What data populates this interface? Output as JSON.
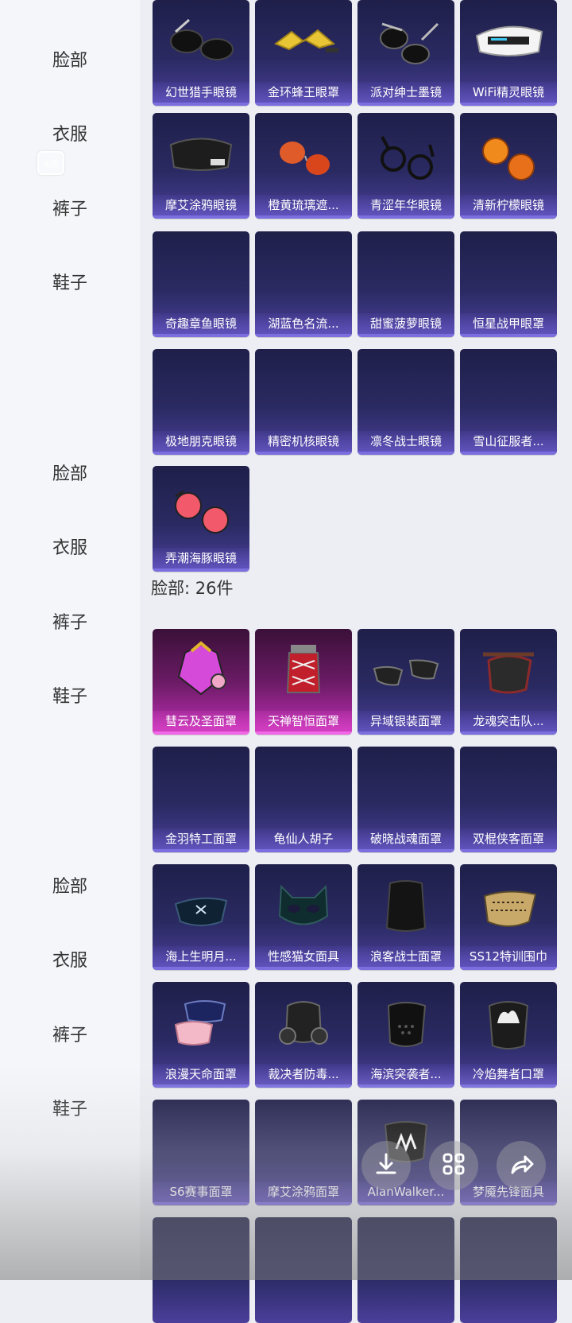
{
  "sidebar": {
    "items": [
      {
        "label": "脸部"
      },
      {
        "label": "衣服"
      },
      {
        "label": "裤子"
      },
      {
        "label": "鞋子"
      },
      {
        "label": "脸部"
      },
      {
        "label": "衣服"
      },
      {
        "label": "裤子"
      },
      {
        "label": "鞋子"
      },
      {
        "label": "脸部"
      },
      {
        "label": "衣服"
      },
      {
        "label": "裤子"
      },
      {
        "label": "鞋子"
      }
    ],
    "long_screenshot_badge": "长图"
  },
  "glasses": [
    {
      "name": "幻世猎手眼镜"
    },
    {
      "name": "金环蜂王眼罩"
    },
    {
      "name": "派对绅士墨镜"
    },
    {
      "name": "WiFi精灵眼镜"
    },
    {
      "name": "摩艾涂鸦眼镜"
    },
    {
      "name": "橙黄琉璃遮..."
    },
    {
      "name": "青涩年华眼镜"
    },
    {
      "name": "清新柠檬眼镜"
    },
    {
      "name": "奇趣章鱼眼镜"
    },
    {
      "name": "湖蓝色名流..."
    },
    {
      "name": "甜蜜菠萝眼镜"
    },
    {
      "name": "恒星战甲眼罩"
    },
    {
      "name": "极地朋克眼镜"
    },
    {
      "name": "精密机核眼镜"
    },
    {
      "name": "凛冬战士眼镜"
    },
    {
      "name": "雪山征服者..."
    },
    {
      "name": "弄潮海豚眼镜"
    }
  ],
  "face_section": {
    "title": "脸部: 26件"
  },
  "face_items": [
    {
      "name": "彗云及圣面罩"
    },
    {
      "name": "天禅智恒面罩"
    },
    {
      "name": "异域银装面罩"
    },
    {
      "name": "龙魂突击队..."
    },
    {
      "name": "金羽特工面罩"
    },
    {
      "name": "龟仙人胡子"
    },
    {
      "name": "破晓战魂面罩"
    },
    {
      "name": "双棍侠客面罩"
    },
    {
      "name": "海上生明月..."
    },
    {
      "name": "性感猫女面具"
    },
    {
      "name": "浪客战士面罩"
    },
    {
      "name": "SS12特训围巾"
    },
    {
      "name": "浪漫天命面罩"
    },
    {
      "name": "裁决者防毒..."
    },
    {
      "name": "海滨突袭者..."
    },
    {
      "name": "冷焰舞者口罩"
    },
    {
      "name": "S6赛事面罩"
    },
    {
      "name": "摩艾涂鸦面罩"
    },
    {
      "name": "AlanWalker..."
    },
    {
      "name": "梦魇先锋面具"
    }
  ],
  "actions": {
    "download": "download-icon",
    "grid": "grid-icon",
    "share": "share-icon"
  }
}
